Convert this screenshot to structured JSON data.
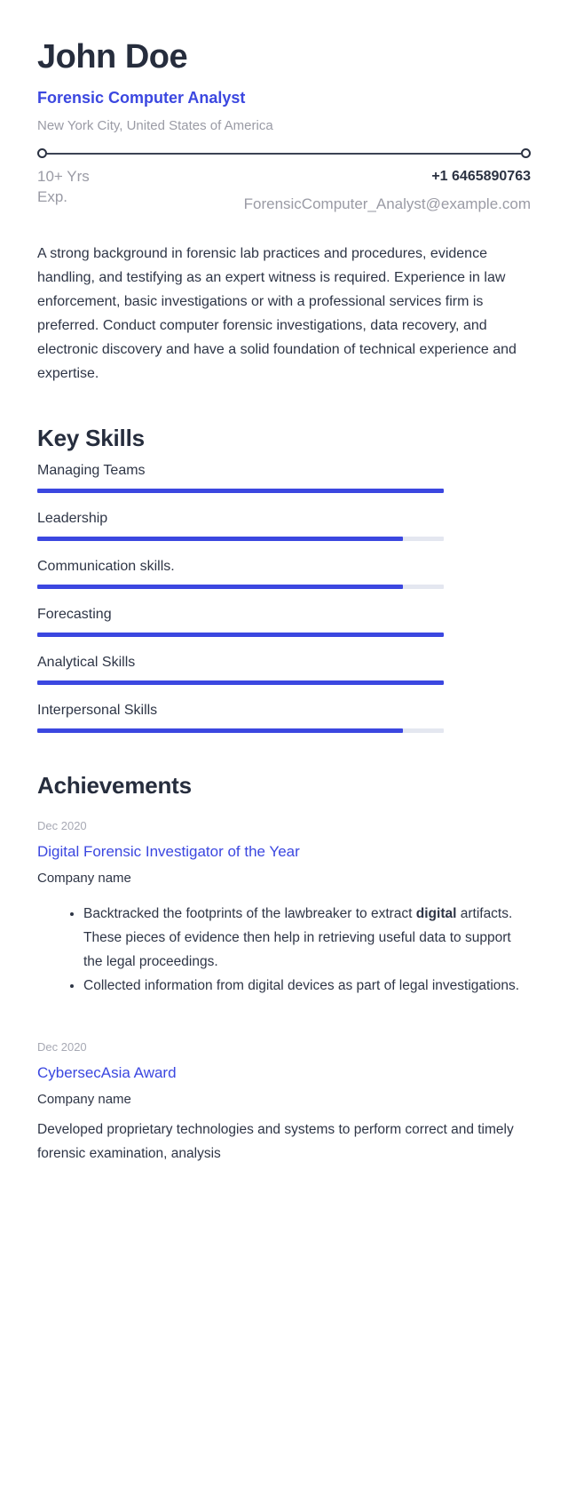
{
  "header": {
    "name": "John Doe",
    "job_title": "Forensic Computer Analyst",
    "location": "New York City, United States of America",
    "experience": "10+ Yrs Exp.",
    "phone": "+1 6465890763",
    "email": "ForensicComputer_Analyst@example.com"
  },
  "summary": {
    "text": "A strong background in forensic lab practices and procedures, evidence handling, and testifying as an expert witness is required. Experience in law enforcement, basic investigations or with a professional services firm is preferred. Conduct computer forensic investigations, data recovery, and electronic discovery and have a solid foundation of technical experience and expertise."
  },
  "key_skills": {
    "heading": "Key Skills",
    "items": [
      {
        "label": "Managing Teams",
        "level": 100
      },
      {
        "label": "Leadership",
        "level": 90
      },
      {
        "label": "Communication skills.",
        "level": 90
      },
      {
        "label": "Forecasting",
        "level": 100
      },
      {
        "label": "Analytical Skills",
        "level": 100
      },
      {
        "label": "Interpersonal Skills",
        "level": 90
      }
    ]
  },
  "achievements": {
    "heading": "Achievements",
    "items": [
      {
        "date": "Dec 2020",
        "title": "Digital Forensic Investigator of the Year",
        "company": "Company name",
        "bullets": [
          {
            "pre": "Backtracked the footprints of the lawbreaker to extract ",
            "bold": "digital",
            "post": " artifacts. These pieces of evidence then help in retrieving useful data to support the legal proceedings."
          },
          {
            "pre": " Collected information from digital devices as part of legal investigations.",
            "bold": "",
            "post": ""
          }
        ]
      },
      {
        "date": "Dec 2020",
        "title": "CybersecAsia Award",
        "company": "Company name",
        "description": "Developed proprietary technologies and systems to perform correct and timely forensic examination, analysis"
      }
    ]
  },
  "colors": {
    "accent": "#3b47e0",
    "heading": "#262d3d",
    "body": "#2e3546",
    "muted": "#9a9ba5",
    "track": "#e4e7f0"
  }
}
